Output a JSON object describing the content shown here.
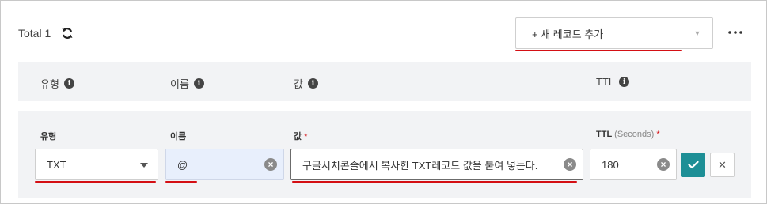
{
  "toolbar": {
    "total_label": "Total 1",
    "add_record_label": "+ 새 레코드 추가",
    "add_dropdown_glyph": "▼",
    "refresh_icon": "refresh-icon",
    "more_icon": "more-dots-icon"
  },
  "table_header": {
    "columns": [
      "유형",
      "이름",
      "값",
      "TTL"
    ],
    "info_glyph": "i"
  },
  "edit_row": {
    "type_label": "유형",
    "name_label": "이름",
    "value_label": "값",
    "value_required": "*",
    "ttl_label": "TTL",
    "ttl_hint": "(Seconds)",
    "ttl_required": "*",
    "type_value": "TXT",
    "name_value": "@",
    "value_value": "구글서치콘솔에서 복사한  TXT레코드 값을 붙여 넣는다.",
    "ttl_value": "180",
    "clear_glyph": "×",
    "cancel_glyph": "✕"
  },
  "colors": {
    "accent": "#1e8f96",
    "highlight_underline": "#d40f14",
    "header_bg": "#f2f3f5",
    "autofill_bg": "#e8effc"
  }
}
